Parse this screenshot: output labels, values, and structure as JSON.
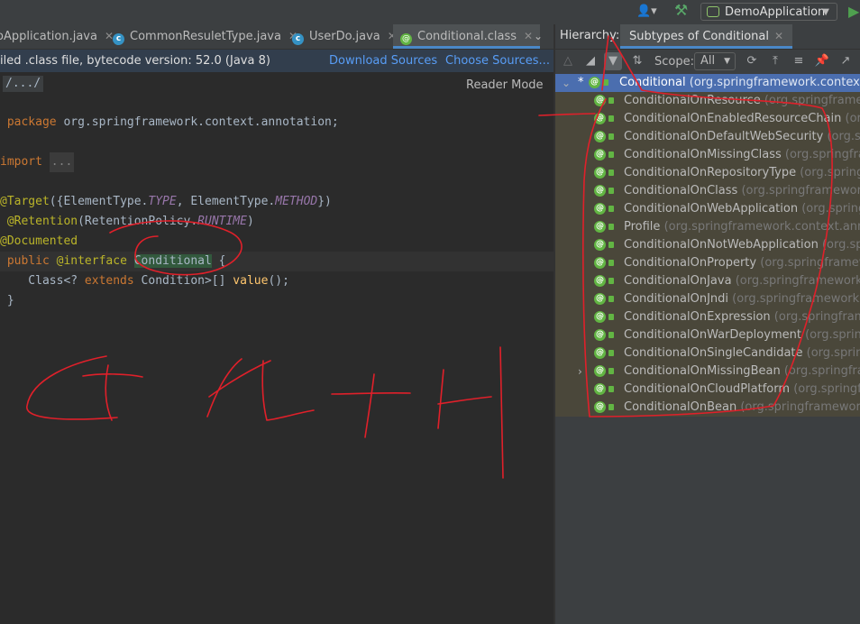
{
  "toolbar": {
    "run_config": "DemoApplication"
  },
  "editor_tabs": [
    {
      "label": "oApplication.java",
      "icon": "class-icon"
    },
    {
      "label": "CommonResuletType.java",
      "icon": "class-icon"
    },
    {
      "label": "UserDo.java",
      "icon": "class-icon"
    },
    {
      "label": "Conditional.class",
      "icon": "annotation-icon",
      "active": true
    }
  ],
  "notice": {
    "text": "iled .class file, bytecode version: 52.0 (Java 8)",
    "download": "Download Sources",
    "choose": "Choose Sources..."
  },
  "breadcrumb": "/.../",
  "reader_mode": "Reader Mode",
  "code": {
    "package_kw": "package",
    "package_name": " org.springframework.context.annotation;",
    "import_kw": "import",
    "import_fold": "...",
    "target_ann": "@Target",
    "target_a": "({ElementType.",
    "target_b": "TYPE",
    "target_c": ", ElementType.",
    "target_d": "METHOD",
    "target_e": "})",
    "retention_ann": "@Retention",
    "retention_a": "(RetentionPolicy.",
    "retention_b": "RUNTIME",
    "retention_c": ")",
    "documented_ann": "@Documented",
    "public_kw": "public",
    "interface_kw": "@interface",
    "iface_name": "Conditional",
    "brace_open": " {",
    "member_a": "    Class<? ",
    "member_kw": "extends",
    "member_b": " Condition>[] ",
    "member_fn": "value",
    "member_c": "();",
    "brace_close": "}"
  },
  "hierarchy": {
    "label": "Hierarchy:",
    "tab": "Subtypes of Conditional",
    "scope_label": "Scope:",
    "scope_value": "All",
    "root": {
      "name": "Conditional",
      "pkg": "(org.springframework.context.annotation)"
    },
    "items": [
      {
        "name": "ConditionalOnResource",
        "pkg": "(org.springframework.boot.autoconfigure.condition)"
      },
      {
        "name": "ConditionalOnEnabledResourceChain",
        "pkg": "(org.springframework.boot.autoconfigure.web)"
      },
      {
        "name": "ConditionalOnDefaultWebSecurity",
        "pkg": "(org.springframework.boot.autoconfigure.security)"
      },
      {
        "name": "ConditionalOnMissingClass",
        "pkg": "(org.springframework.boot.autoconfigure.condition)"
      },
      {
        "name": "ConditionalOnRepositoryType",
        "pkg": "(org.springframework.boot.autoconfigure.data)"
      },
      {
        "name": "ConditionalOnClass",
        "pkg": "(org.springframework.boot.autoconfigure.condition)"
      },
      {
        "name": "ConditionalOnWebApplication",
        "pkg": "(org.springframework.boot.autoconfigure.condition)"
      },
      {
        "name": "Profile",
        "pkg": "(org.springframework.context.annotation)"
      },
      {
        "name": "ConditionalOnNotWebApplication",
        "pkg": "(org.springframework.boot.autoconfigure.condition)"
      },
      {
        "name": "ConditionalOnProperty",
        "pkg": "(org.springframework.boot.autoconfigure.condition)"
      },
      {
        "name": "ConditionalOnJava",
        "pkg": "(org.springframework.boot.autoconfigure.condition)"
      },
      {
        "name": "ConditionalOnJndi",
        "pkg": "(org.springframework.boot.autoconfigure.condition)"
      },
      {
        "name": "ConditionalOnExpression",
        "pkg": "(org.springframework.boot.autoconfigure.condition)"
      },
      {
        "name": "ConditionalOnWarDeployment",
        "pkg": "(org.springframework.boot.autoconfigure.condition)"
      },
      {
        "name": "ConditionalOnSingleCandidate",
        "pkg": "(org.springframework.boot.autoconfigure.condition)"
      },
      {
        "name": "ConditionalOnMissingBean",
        "pkg": "(org.springframework.boot.autoconfigure.condition)",
        "expandable": true
      },
      {
        "name": "ConditionalOnCloudPlatform",
        "pkg": "(org.springframework.boot.autoconfigure.condition)"
      },
      {
        "name": "ConditionalOnBean",
        "pkg": "(org.springframework.boot.autoconfigure.condition)"
      }
    ]
  },
  "colors": {
    "selection": "#4b6eaf",
    "annotation_icon": "#62b543",
    "ink": "#e0202a"
  }
}
